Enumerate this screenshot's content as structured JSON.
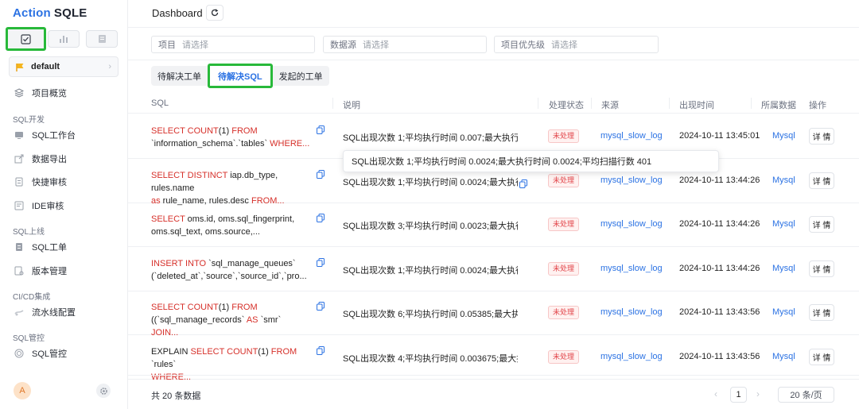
{
  "brand": {
    "part1": "Action",
    "part2": "SQLE"
  },
  "project": {
    "name": "default"
  },
  "nav": {
    "overview": "项目概览",
    "sect_dev": "SQL开发",
    "workbench": "SQL工作台",
    "export": "数据导出",
    "quick_audit": "快捷审核",
    "ide_audit": "IDE审核",
    "sect_release": "SQL上线",
    "workorder": "SQL工单",
    "version": "版本管理",
    "sect_cicd": "CI/CD集成",
    "pipeline": "流水线配置",
    "sect_ctrl": "SQL管控",
    "sql_ctrl": "SQL管控"
  },
  "user": {
    "avatar": "A"
  },
  "page": {
    "title": "Dashboard"
  },
  "filters": [
    {
      "label": "项目",
      "placeholder": "请选择"
    },
    {
      "label": "数据源",
      "placeholder": "请选择"
    },
    {
      "label": "项目优先级",
      "placeholder": "请选择"
    }
  ],
  "tabs": [
    "待解决工单",
    "待解决SQL",
    "发起的工单"
  ],
  "active_tab": "待解决SQL",
  "table": {
    "headers": [
      "SQL",
      "说明",
      "处理状态",
      "来源",
      "出现时间",
      "所属数据",
      "操作"
    ],
    "rows": [
      {
        "sql": [
          [
            "SELECT COUNT",
            "kw"
          ],
          [
            "(1) ",
            ""
          ],
          [
            "FROM",
            "kw"
          ],
          [
            "\n`information_schema`.`tables` ",
            ""
          ],
          [
            "WHERE...",
            "kw"
          ]
        ],
        "desc": "SQL出现次数 1;平均执行时间 0.007;最大执行时...",
        "status": "未处理",
        "source": "mysql_slow_log",
        "time": "2024-10-11 13:45:01",
        "inst": "Mysql",
        "action": "详 情"
      },
      {
        "sql": [
          [
            "SELECT DISTINCT",
            "kw"
          ],
          [
            " iap.db_type, rules.name\n",
            ""
          ],
          [
            "as",
            "kw"
          ],
          [
            " rule_name, rules.desc ",
            ""
          ],
          [
            "FROM...",
            "kw"
          ]
        ],
        "desc": "SQL出现次数 1;平均执行时间 0.0024;最大执行i...",
        "status": "未处理",
        "source": "mysql_slow_log",
        "time": "2024-10-11 13:44:26",
        "inst": "Mysql",
        "action": "详 情"
      },
      {
        "sql": [
          [
            "SELECT",
            "kw"
          ],
          [
            " oms.id, oms.sql_fingerprint,\noms.sql_text, oms.source,...",
            ""
          ]
        ],
        "desc": "SQL出现次数 3;平均执行时间 0.0023;最大执行...",
        "status": "未处理",
        "source": "mysql_slow_log",
        "time": "2024-10-11 13:44:26",
        "inst": "Mysql",
        "action": "详 情"
      },
      {
        "sql": [
          [
            "INSERT INTO",
            "kw"
          ],
          [
            " `sql_manage_queues`\n(`deleted_at`,`source`,`source_id`,`pro...",
            ""
          ]
        ],
        "desc": "SQL出现次数 1;平均执行时间 0.0024;最大执行i...",
        "status": "未处理",
        "source": "mysql_slow_log",
        "time": "2024-10-11 13:44:26",
        "inst": "Mysql",
        "action": "详 情"
      },
      {
        "sql": [
          [
            "SELECT COUNT",
            "kw"
          ],
          [
            "(1) ",
            ""
          ],
          [
            "FROM",
            "kw"
          ],
          [
            "\n((`sql_manage_records` ",
            ""
          ],
          [
            "AS",
            "kw"
          ],
          [
            " `smr` ",
            ""
          ],
          [
            "JOIN...",
            "kw"
          ]
        ],
        "desc": "SQL出现次数 6;平均执行时间 0.05385;最大执行...",
        "status": "未处理",
        "source": "mysql_slow_log",
        "time": "2024-10-11 13:43:56",
        "inst": "Mysql",
        "action": "详 情"
      },
      {
        "sql": [
          [
            "EXPLAIN ",
            ""
          ],
          [
            "SELECT COUNT",
            "kw"
          ],
          [
            "(1) ",
            ""
          ],
          [
            "FROM",
            "kw"
          ],
          [
            " `rules`\n",
            ""
          ],
          [
            "WHERE...",
            "kw"
          ]
        ],
        "desc": "SQL出现次数 4;平均执行时间 0.003675;最大执行...",
        "status": "未处理",
        "source": "mysql_slow_log",
        "time": "2024-10-11 13:43:56",
        "inst": "Mysql",
        "action": "详 情"
      }
    ]
  },
  "tooltip": "SQL出现次数 1;平均执行时间 0.0024;最大执行时间 0.0024;平均扫描行数 401",
  "pagination": {
    "total": "共 20 条数据",
    "page": "1",
    "size": "20 条/页"
  },
  "colors": {
    "accent": "#2b72e3",
    "highlight": "#28b93a",
    "keyword": "#d6302a",
    "status": "#e2454a"
  }
}
